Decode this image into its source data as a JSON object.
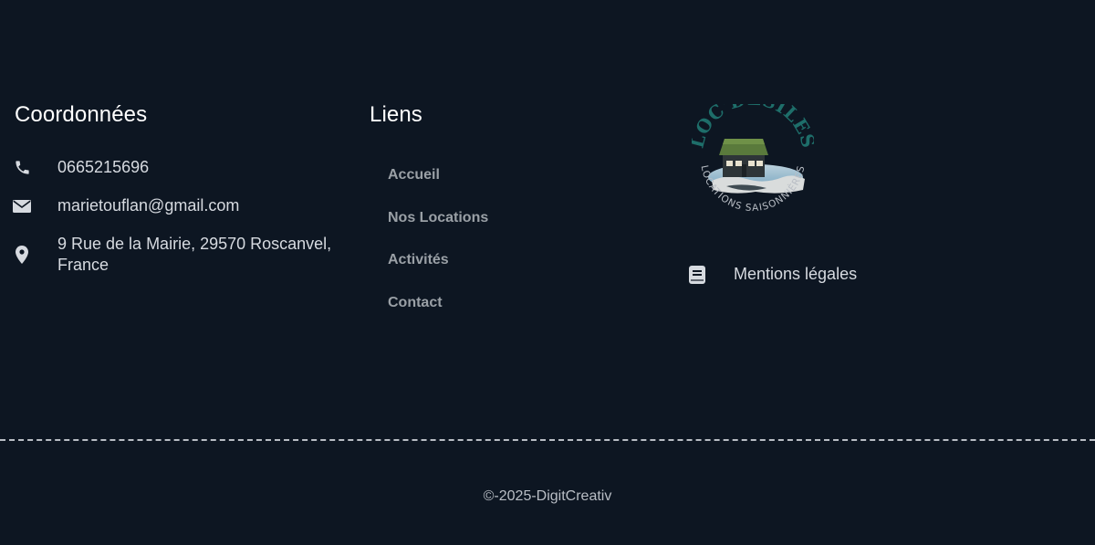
{
  "contact": {
    "title": "Coordonnées",
    "phone": "0665215696",
    "email": "marietouflan@gmail.com",
    "address": "9 Rue de la Mairie, 29570 Roscanvel, France",
    "icons": [
      "phone-icon",
      "envelope-icon",
      "map-pin-icon"
    ]
  },
  "links": {
    "title": "Liens",
    "items": [
      {
        "label": "Accueil"
      },
      {
        "label": "Nos Locations"
      },
      {
        "label": "Activités"
      },
      {
        "label": "Contact"
      }
    ]
  },
  "brand": {
    "logo_text_top": "LOC'DESILES",
    "logo_text_bottom": "LOCATIONS SAISONNIÈRES",
    "legal_label": "Mentions légales",
    "legal_icon": "book-icon"
  },
  "footer_bottom": {
    "copyright": "©-2025-DigitCreativ"
  },
  "colors": {
    "background": "#0d1622",
    "title": "#ffffff",
    "text": "#d6dae0",
    "link": "#9aa0a6",
    "logo_teal": "#1e6e6a"
  }
}
